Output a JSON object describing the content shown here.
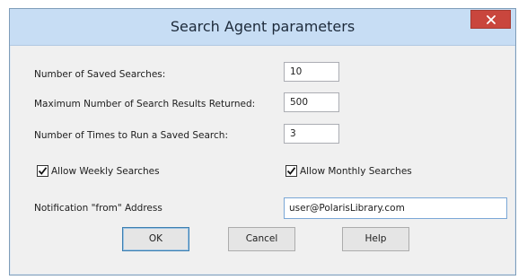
{
  "window": {
    "title": "Search Agent parameters",
    "close_glyph": "✕"
  },
  "fields": {
    "saved_searches_label": "Number of Saved Searches:",
    "saved_searches_value": "10",
    "max_results_label": "Maximum Number of Search Results Returned:",
    "max_results_value": "500",
    "times_to_run_label": "Number of Times to Run a Saved Search:",
    "times_to_run_value": "3",
    "notification_label": "Notification \"from\" Address",
    "notification_value": "user@PolarisLibrary.com"
  },
  "checkboxes": {
    "weekly_label": "Allow Weekly Searches",
    "weekly_checked": true,
    "monthly_label": "Allow Monthly Searches",
    "monthly_checked": true
  },
  "buttons": {
    "ok": "OK",
    "cancel": "Cancel",
    "help": "Help"
  },
  "colors": {
    "titlebar": "#c7ddf4",
    "close_button": "#c9463d",
    "dialog_background": "#f0f0f0"
  },
  "icons": {
    "close": "close-icon",
    "check": "checkmark-icon"
  }
}
